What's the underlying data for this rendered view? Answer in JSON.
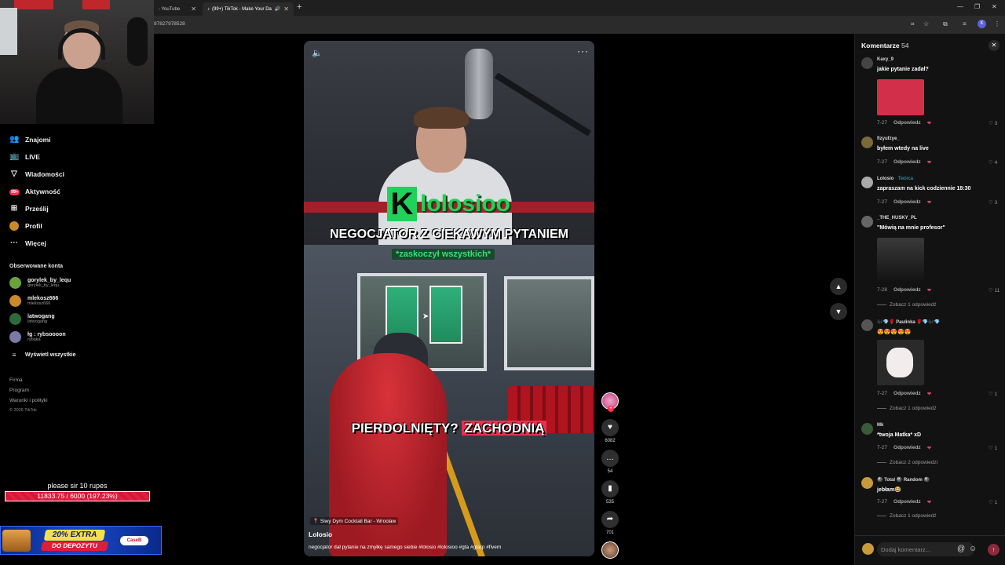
{
  "browser": {
    "tabs": [
      {
        "label": "- YouTube"
      },
      {
        "label": "(99+) TikTok - Make Your Da"
      }
    ],
    "url": "97827978528",
    "profile_initial": "K"
  },
  "nav": {
    "items": [
      {
        "label": "Znajomi",
        "icon": "friends-icon"
      },
      {
        "label": "LIVE",
        "icon": "live-icon"
      },
      {
        "label": "Wiadomości",
        "icon": "messages-icon"
      },
      {
        "label": "Aktywność",
        "icon": "activity-icon",
        "badge": "99+"
      },
      {
        "label": "Prześlij",
        "icon": "upload-icon"
      },
      {
        "label": "Profil",
        "icon": "profile-icon"
      },
      {
        "label": "Więcej",
        "icon": "more-icon"
      }
    ],
    "following_title": "Obserwowane konta",
    "following": [
      {
        "name": "gorylek_by_lequ",
        "handle": "gorylek_by_lequ",
        "color": "#6aa33a"
      },
      {
        "name": "mlekosz666",
        "handle": "mlekosz666",
        "color": "#c98a2c"
      },
      {
        "name": "latwogang",
        "handle": "latwogang",
        "color": "#2f6b3a"
      },
      {
        "name": "łg : rybsoooon",
        "handle": "rybqka",
        "color": "#7a7aa8"
      }
    ],
    "show_all": "Wyświetl wszystkie",
    "footer": [
      "Firma",
      "Program",
      "Warunki i polityki"
    ],
    "copyright": "© 2026 TikTok"
  },
  "donation": {
    "title": "please sir 10 rupes",
    "progress_text": "11833.75 / 6000 (197.23%)",
    "progress_fraction": 1.0
  },
  "ad": {
    "main": "20% EXTRA",
    "sub": "DO DEPOZYTU",
    "logo": "CaseB"
  },
  "video": {
    "brand_letter": "K",
    "brand_name": "lolosioo",
    "title": "NEGOCJATOR Z CIEKAWYM PYTANIEM",
    "subtitle": "*zaskoczył wszystkich*",
    "bottom_text_a": "PIERDOLNIĘTY?",
    "bottom_text_b": "ZACHODNIĄ",
    "location": "Siwy Dym Cocktail Bar - Wrocław",
    "author": "Lolosio",
    "caption": "negocjator dał pytanie na zmyłkę samego siebie #lolosio #lolosioo #gta #gtarp #fivem",
    "colors": {
      "accent_green": "#1fd35a",
      "highlight": "#e9304f"
    }
  },
  "actions": {
    "likes": "6082",
    "comments": "54",
    "saves": "535",
    "shares": "701"
  },
  "comments_panel": {
    "title": "Komentarze",
    "count": "54",
    "input_placeholder": "Dodaj komentarz...",
    "reply_label": "Odpowiedz",
    "items": [
      {
        "user": "Kaxy_9",
        "text": "jakie pytanie zadał?",
        "date": "7-27",
        "likes": "3",
        "has_image": true,
        "image_color": "#d2304a"
      },
      {
        "user": "fizyufzye_",
        "text": "byłem wtedy na live",
        "date": "7-27",
        "likes": "4"
      },
      {
        "user": "Lolosio",
        "creator": "· Twórca",
        "text": "zapraszam na kick codziennie 18:30",
        "date": "7-27",
        "likes": "3"
      },
      {
        "user": "_THE_HUSKY_PL",
        "text": "\"Mówią na mnie profesor\"",
        "date": "7-28",
        "likes": "11",
        "has_image": true,
        "image_color": "#5a5a5a",
        "replies": "Zobacz 1 odpowiedź"
      },
      {
        "user": "🎶💎🌹 Paulinka 🌹💎🎶💎",
        "text": "😍😍😍😍😍",
        "date": "7-27",
        "likes": "1",
        "has_image": true,
        "image_color": "#e9e3e3",
        "replies": "Zobacz 1 odpowiedź"
      },
      {
        "user": "Mk",
        "text": "*twoja Matka* xD",
        "date": "7-27",
        "likes": "1",
        "replies": "Zobacz 2 odpowiedzi"
      },
      {
        "user": "🎱 Total 🎱 Random 🎱",
        "text": "jebłam😂",
        "date": "7-27",
        "likes": "1",
        "replies": "Zobacz 1 odpowiedź"
      }
    ]
  }
}
